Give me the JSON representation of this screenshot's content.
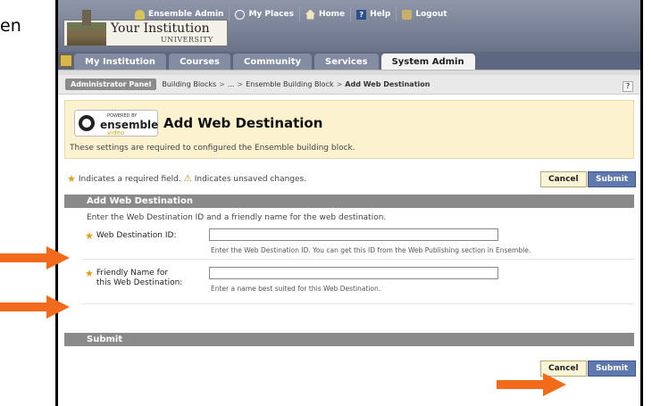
{
  "left_text": "en",
  "header": {
    "institution_name": "Your Institution",
    "institution_sub": "UNIVERSITY",
    "nav": [
      {
        "label": "Ensemble Admin",
        "icon": "user-icon"
      },
      {
        "label": "My Places",
        "icon": "places-icon"
      },
      {
        "label": "Home",
        "icon": "home-icon"
      },
      {
        "label": "Help",
        "icon": "help-icon"
      },
      {
        "label": "Logout",
        "icon": "logout-icon"
      }
    ]
  },
  "tabs": [
    {
      "label": "My Institution"
    },
    {
      "label": "Courses"
    },
    {
      "label": "Community"
    },
    {
      "label": "Services"
    },
    {
      "label": "System Admin"
    }
  ],
  "breadcrumb": {
    "button": "Administrator Panel",
    "items": [
      "Building Blocks",
      "...",
      "Ensemble Building Block",
      "Add Web Destination"
    ],
    "help": "?"
  },
  "ensemble_logo": {
    "powered": "POWERED BY",
    "name": "ensemble",
    "video": "video"
  },
  "page": {
    "title": "Add Web Destination",
    "description": "These settings are required to configured the Ensemble building block."
  },
  "required_note": {
    "part1": "Indicates a required field.",
    "part2": "Indicates unsaved changes."
  },
  "buttons": {
    "cancel": "Cancel",
    "submit": "Submit"
  },
  "section1": {
    "title": "Add Web Destination",
    "instructions": "Enter the Web Destination ID and a friendly name for the web destination.",
    "fields": [
      {
        "label": "Web Destination ID:",
        "value": "",
        "hint": "Enter the Web Destination ID. You can get this ID from the Web Publishing section in Ensemble."
      },
      {
        "label_line1": "Friendly Name for",
        "label_line2": "this Web Destination:",
        "value": "",
        "hint": "Enter a name best suited for this Web Destination."
      }
    ]
  },
  "section2": {
    "title": "Submit"
  },
  "colors": {
    "arrow": "#f26a1b",
    "accent": "#5f78ad",
    "star": "#e69a18"
  }
}
